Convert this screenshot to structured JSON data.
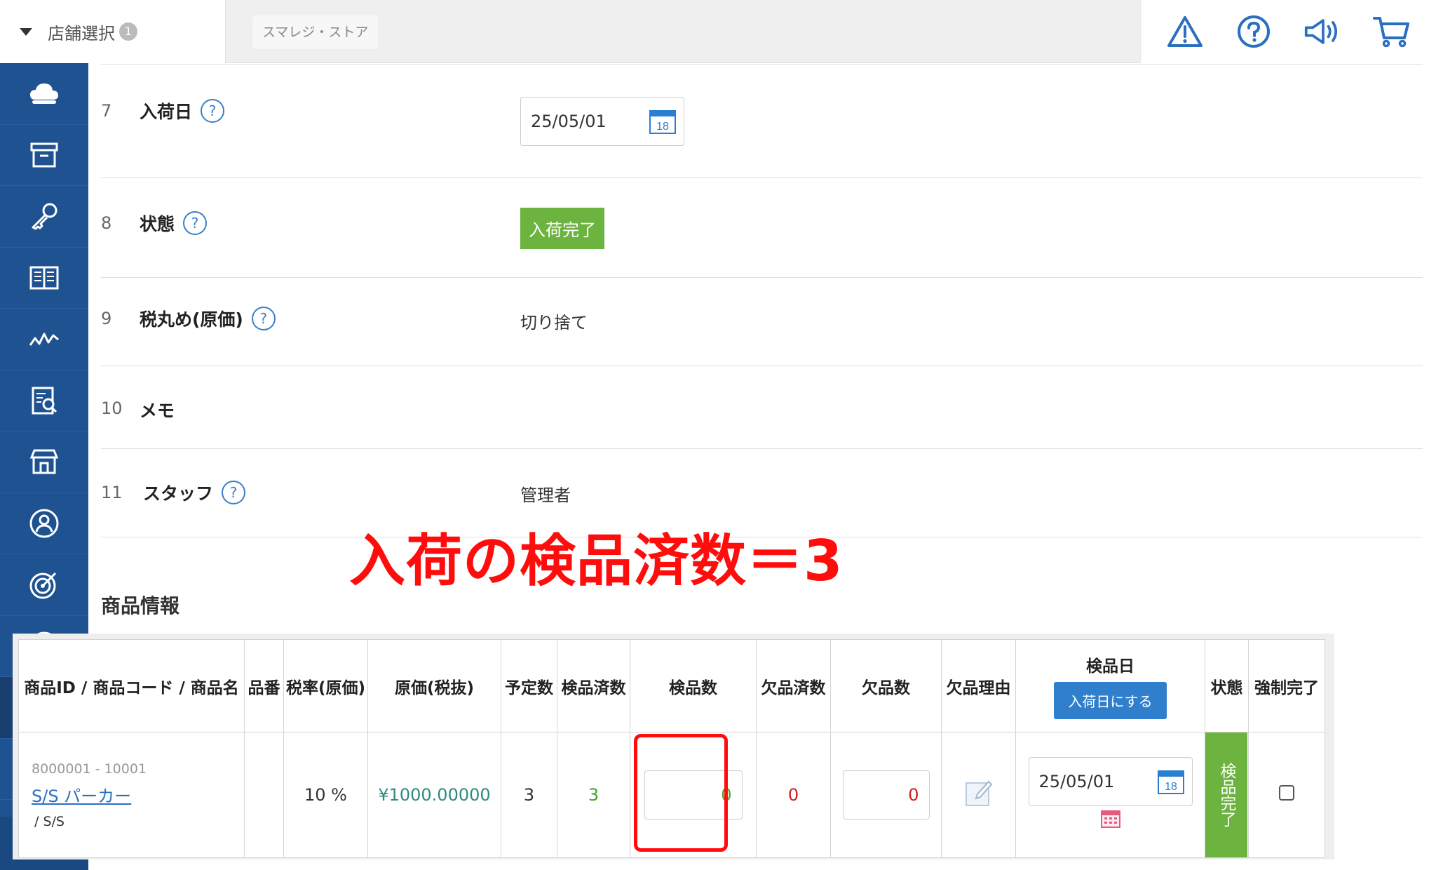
{
  "topbar": {
    "store_select_label": "店舗選択",
    "store_select_badge": "1",
    "store_chip": "スマレジ・ストア",
    "icons": [
      "warning-icon",
      "help-icon",
      "megaphone-icon",
      "cart-icon"
    ]
  },
  "sidebar": {
    "items": [
      "cloud-icon",
      "box-icon",
      "key-icon",
      "book-icon",
      "chart-icon",
      "report-icon",
      "store-icon",
      "customer-icon",
      "target-icon",
      "user-icon",
      "grid-icon",
      "clipboard-icon"
    ],
    "active_index": 10,
    "settings_icon": "gear-icon"
  },
  "form": {
    "rows": [
      {
        "num": "7",
        "label": "入荷日",
        "value": "25/05/01"
      },
      {
        "num": "8",
        "label": "状態",
        "value": "入荷完了"
      },
      {
        "num": "9",
        "label": "税丸め(原価)",
        "value": "切り捨て"
      },
      {
        "num": "10",
        "label": "メモ",
        "value": ""
      },
      {
        "num": "11",
        "label": "スタッフ",
        "value": "管理者"
      }
    ],
    "help_glyph": "?"
  },
  "products": {
    "section_title": "商品情報",
    "annotation": "入荷の検品済数＝3",
    "headers": {
      "product": "商品ID / 商品コード / 商品名",
      "hinban": "品番",
      "tax_rate": "税率(原価)",
      "cost": "原価(税抜)",
      "planned": "予定数",
      "inspected_done": "検品済数",
      "inspect_count": "検品数",
      "shortage_done": "欠品済数",
      "shortage_count": "欠品数",
      "shortage_reason": "欠品理由",
      "inspect_date": "検品日",
      "set_arrival_date_button": "入荷日にする",
      "status": "状態",
      "force_complete": "強制完了"
    },
    "row": {
      "ids": "8000001 - 10001",
      "name": "S/S パーカー",
      "sub": "/ S/S",
      "hinban": "",
      "tax_rate": "10 %",
      "cost": "¥1000.00000",
      "planned": "3",
      "inspected_done": "3",
      "inspect_count": "0",
      "shortage_done": "0",
      "shortage_count": "0",
      "inspect_date": "25/05/01",
      "status": "検品完了"
    }
  },
  "colors": {
    "sidebar": "#1f5290",
    "accent_blue": "#2f7fcd",
    "status_green": "#6cb33f",
    "annotation_red": "#ff0d0d"
  }
}
